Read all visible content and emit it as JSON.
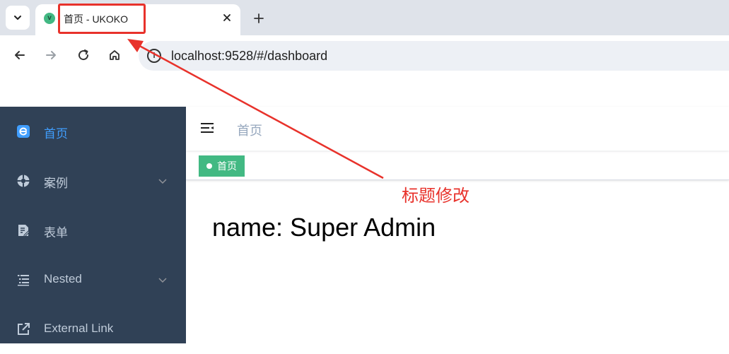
{
  "browser": {
    "tab": {
      "title": "首页 - UKOKO",
      "favicon_letter": "v"
    },
    "url": "localhost:9528/#/dashboard",
    "icons": [
      "chevron-down-icon",
      "close-icon",
      "plus-icon",
      "back-icon",
      "forward-icon",
      "reload-icon",
      "home-icon",
      "info-icon"
    ]
  },
  "sidebar": {
    "items": [
      {
        "label": "首页",
        "icon": "dashboard-icon",
        "active": true,
        "has_children": false
      },
      {
        "label": "案例",
        "icon": "example-icon",
        "active": false,
        "has_children": true
      },
      {
        "label": "表单",
        "icon": "form-icon",
        "active": false,
        "has_children": false
      },
      {
        "label": "Nested",
        "icon": "nested-icon",
        "active": false,
        "has_children": true
      },
      {
        "label": "External Link",
        "icon": "link-icon",
        "active": false,
        "has_children": false
      }
    ]
  },
  "navbar": {
    "breadcrumb": "首页"
  },
  "tags_view": {
    "tags": [
      {
        "label": "首页",
        "active": true
      }
    ]
  },
  "dashboard": {
    "text": "name: Super Admin"
  },
  "annotation": {
    "label": "标题修改"
  },
  "colors": {
    "sidebar_bg": "#304156",
    "sidebar_text": "#bfcbd9",
    "active_text": "#409eff",
    "tag_green": "#42b983",
    "annotation_red": "#e8322b"
  }
}
